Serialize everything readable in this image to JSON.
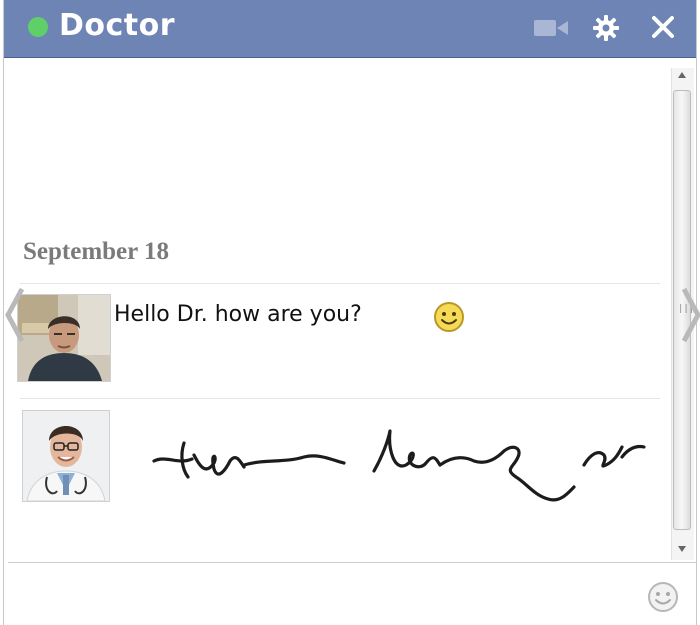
{
  "chat": {
    "title": "Doctor",
    "online_status_color": "#5fcf6a",
    "header_color": "#6d84b4"
  },
  "header_icons": [
    "video-call-icon",
    "gear-icon",
    "close-icon"
  ],
  "conversation": {
    "date_separator": "September 18",
    "messages": [
      {
        "sender": "patient",
        "avatar": "man-avatar-photo",
        "text": "Hello Dr. how are you?",
        "emoticon": "smiley-icon"
      },
      {
        "sender": "doctor",
        "avatar": "doctor-avatar-photo",
        "text_style": "illegible-handwriting-scribble"
      }
    ]
  },
  "compose": {
    "value": "",
    "emoji_icon": "smiley-icon"
  }
}
